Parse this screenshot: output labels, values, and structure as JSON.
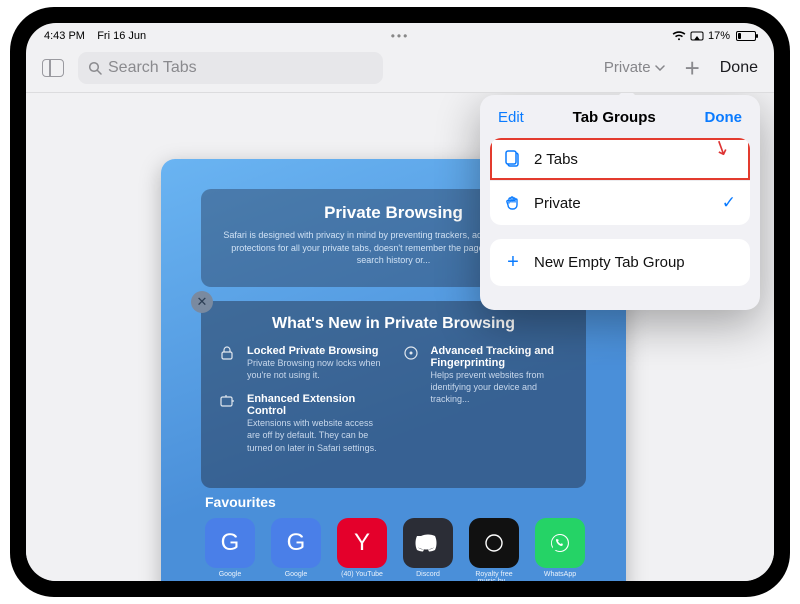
{
  "status": {
    "time": "4:43 PM",
    "date": "Fri 16 Jun",
    "battery_pct": "17%"
  },
  "toolbar": {
    "search_placeholder": "Search Tabs",
    "group_label": "Private",
    "done_label": "Done"
  },
  "card": {
    "pb_title": "Private Browsing",
    "pb_text": "Safari is designed with privacy in mind by preventing trackers, adds additional privacy protections for all your private tabs, doesn't remember the pages you visited, your search history or...",
    "whats_title": "What's New in Private Browsing",
    "f1_title": "Locked Private Browsing",
    "f1_text": "Private Browsing now locks when you're not using it.",
    "f2_title": "Enhanced Extension Control",
    "f2_text": "Extensions with website access are off by default. They can be turned on later in Safari settings.",
    "f3_title": "Advanced Tracking and Fingerprinting",
    "f3_text": "Helps prevent websites from identifying your device and tracking...",
    "fav_title": "Favourites",
    "tiles": [
      {
        "label": "Google",
        "letter": "G",
        "bg": "#4a7fe8"
      },
      {
        "label": "Google",
        "letter": "G",
        "bg": "#4a7fe8"
      },
      {
        "label": "(40) YouTube",
        "letter": "Y",
        "bg": "#e4002b"
      },
      {
        "label": "Discord",
        "letter": "",
        "bg": "#2b2d36"
      },
      {
        "label": "Royalty free music by...",
        "letter": "",
        "bg": "#111"
      },
      {
        "label": "WhatsApp",
        "letter": "",
        "bg": "#25d366"
      }
    ]
  },
  "popover": {
    "edit": "Edit",
    "title": "Tab Groups",
    "done": "Done",
    "rows": [
      {
        "icon": "tabs",
        "label": "2 Tabs",
        "checked": false,
        "highlight": true
      },
      {
        "icon": "hand",
        "label": "Private",
        "checked": true,
        "highlight": false
      }
    ],
    "new_group": "New Empty Tab Group"
  }
}
